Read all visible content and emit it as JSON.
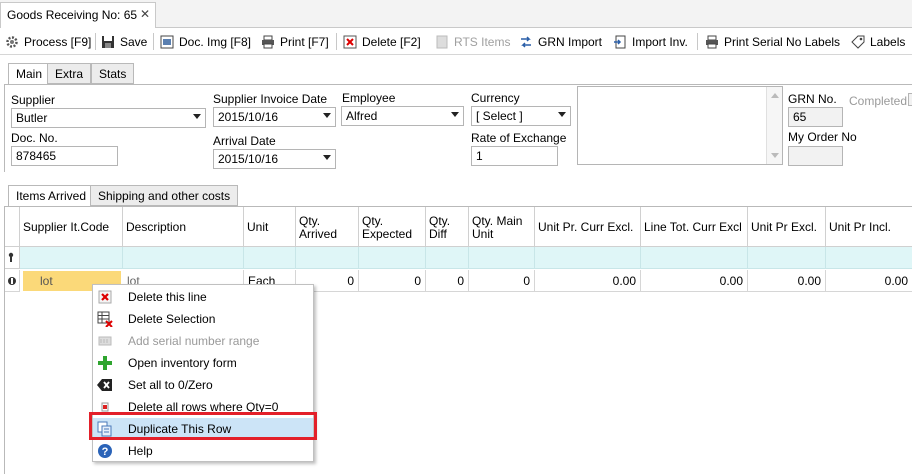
{
  "document_tab": {
    "title": "Goods Receiving No: 65",
    "close": "✕"
  },
  "toolbar": {
    "process": "Process [F9]",
    "save": "Save",
    "doc_img": "Doc. Img [F8]",
    "print": "Print [F7]",
    "delete": "Delete [F2]",
    "rts_items": "RTS Items",
    "grn_import": "GRN Import",
    "import_inv": "Import Inv.",
    "print_serial": "Print Serial No Labels",
    "labels": "Labels"
  },
  "form_tabs": [
    "Main",
    "Extra",
    "Stats"
  ],
  "form": {
    "supplier_label": "Supplier",
    "supplier_value": "Butler",
    "doc_no_label": "Doc. No.",
    "doc_no_value": "878465",
    "supplier_invoice_date_label": "Supplier Invoice Date",
    "supplier_invoice_date_value": "2015/10/16",
    "arrival_date_label": "Arrival Date",
    "arrival_date_value": "2015/10/16",
    "employee_label": "Employee",
    "employee_value": "Alfred",
    "currency_label": "Currency",
    "currency_value": "[ Select ]",
    "rate_label": "Rate of Exchange",
    "rate_value": "1",
    "grn_no_label": "GRN No.",
    "grn_no_value": "65",
    "my_order_label": "My Order No",
    "my_order_value": "",
    "completed_label": "Completed"
  },
  "lower_tabs": [
    "Items Arrived",
    "Shipping and other costs"
  ],
  "grid": {
    "columns": [
      "Supplier It.Code",
      "Description",
      "Unit",
      "Qty. Arrived",
      "Qty. Expected",
      "Qty. Diff",
      "Qty. Main Unit",
      "Unit Pr. Curr Excl.",
      "Line Tot. Curr Excl",
      "Unit Pr Excl.",
      "Unit Pr Incl."
    ],
    "row": [
      "lot",
      "lot",
      "Each",
      "0",
      "0",
      "0",
      "0",
      "0.00",
      "0.00",
      "0.00",
      "0.00"
    ]
  },
  "context_menu": {
    "items": [
      {
        "label": "Delete this line",
        "icon": "red-x-icon",
        "enabled": true
      },
      {
        "label": "Delete Selection",
        "icon": "grid-delete-icon",
        "enabled": true
      },
      {
        "label": "Add serial number range",
        "icon": "serial-icon",
        "enabled": false
      },
      {
        "label": "Open inventory form",
        "icon": "green-plus-icon",
        "enabled": true
      },
      {
        "label": "Set all to 0/Zero",
        "icon": "backspace-icon",
        "enabled": true
      },
      {
        "label": "Delete all rows where Qty=0",
        "icon": "small-red-icon",
        "enabled": true
      },
      {
        "label": "Duplicate This Row",
        "icon": "duplicate-icon",
        "enabled": true,
        "highlighted": true
      },
      {
        "label": "Help",
        "icon": "help-icon",
        "enabled": true
      }
    ]
  },
  "colors": {
    "highlight_box": "#e3202a",
    "filter_row": "#dff6f7",
    "selected_cell": "#fbd979",
    "menu_highlight": "#cce4f7"
  }
}
